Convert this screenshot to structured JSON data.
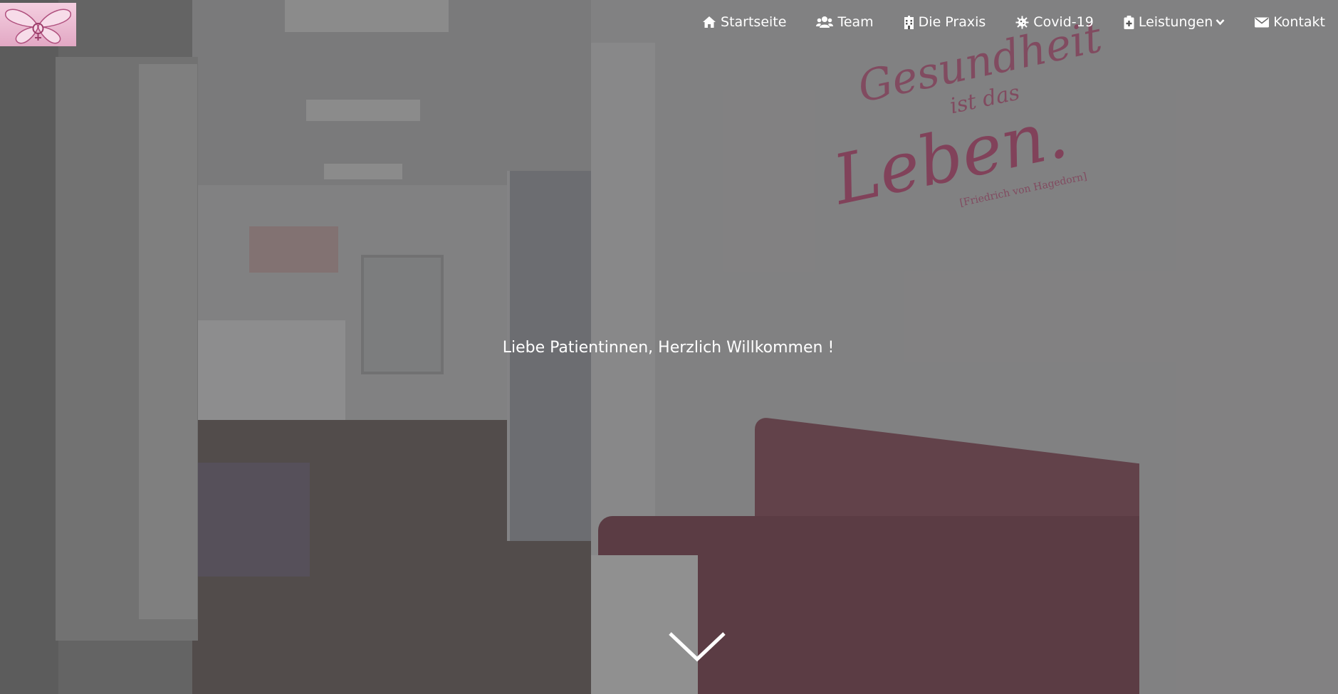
{
  "logo": {
    "icon": "butterfly-logo"
  },
  "nav": {
    "items": [
      {
        "label": "Startseite",
        "icon": "home-icon"
      },
      {
        "label": "Team",
        "icon": "users-icon"
      },
      {
        "label": "Die Praxis",
        "icon": "building-icon"
      },
      {
        "label": "Covid-19",
        "icon": "virus-icon"
      },
      {
        "label": "Leistungen",
        "icon": "clipboard-plus-icon",
        "has_dropdown": true
      },
      {
        "label": "Kontakt",
        "icon": "envelope-icon"
      }
    ]
  },
  "hero": {
    "headline": "Liebe Patientinnen, Herzlich Willkommen !",
    "wall_quote": {
      "line1": "Gesundheit",
      "line2": "ist das",
      "line3": "Leben.",
      "cite": "[Friedrich von Hagedorn]"
    },
    "scroll_icon": "chevron-down-icon"
  },
  "colors": {
    "accent": "#a6466b",
    "text": "#ffffff",
    "bench": "#6c3d49"
  }
}
